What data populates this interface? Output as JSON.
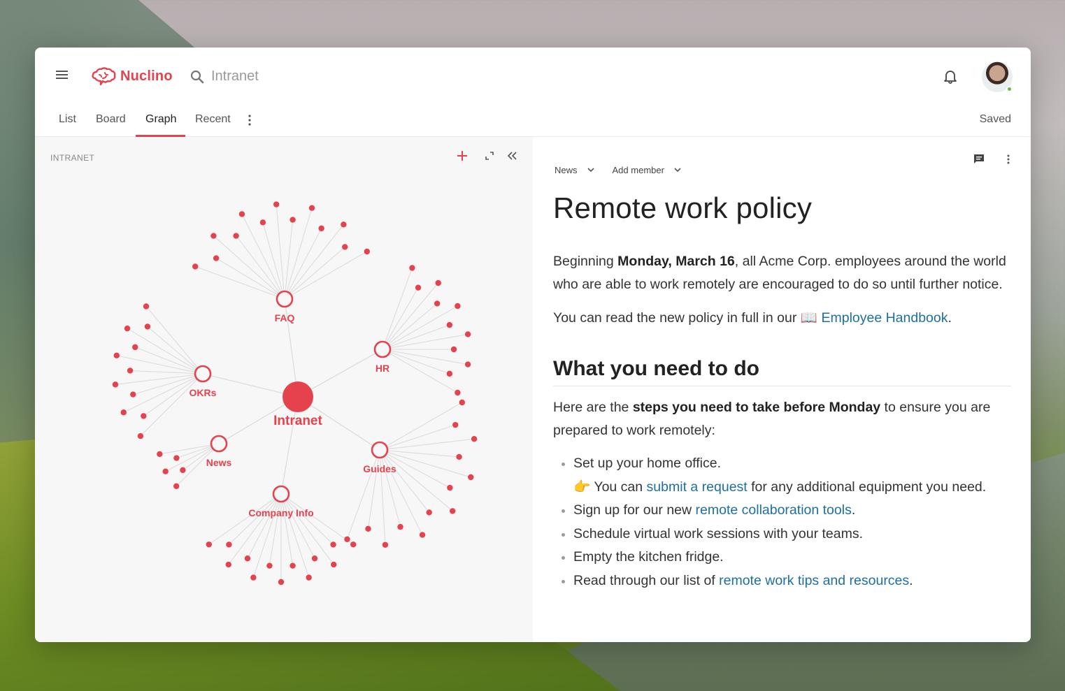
{
  "app": {
    "name": "Nuclino",
    "brand_color": "#e5424d",
    "link_color": "#1e6f9e"
  },
  "header": {
    "search_text": "Intranet",
    "icons": [
      "menu-icon",
      "search-icon",
      "bell-icon"
    ]
  },
  "tabs": [
    {
      "label": "List"
    },
    {
      "label": "Board"
    },
    {
      "label": "Graph",
      "active": true
    },
    {
      "label": "Recent"
    }
  ],
  "status": "Saved",
  "left_pane": {
    "title": "INTRANET",
    "tools": [
      "add-icon",
      "expand-icon",
      "collapse-icon"
    ]
  },
  "graph": {
    "center": "Intranet",
    "clusters": [
      {
        "label": "FAQ",
        "children": 13
      },
      {
        "label": "HR",
        "children": 11
      },
      {
        "label": "OKRs",
        "children": 11
      },
      {
        "label": "News",
        "children": 5
      },
      {
        "label": "Guides",
        "children": 13
      },
      {
        "label": "Company Info",
        "children": 13
      }
    ]
  },
  "document": {
    "meta": {
      "collection": "News",
      "add_member": "Add member"
    },
    "title": "Remote work policy",
    "p1": {
      "t1": "Beginning ",
      "b1": "Monday, March 16",
      "t2": ", all Acme Corp. employees around the world who are able to work remotely are encouraged to do so until further notice."
    },
    "p2": {
      "t1": "You can read the new policy in full in our ",
      "emoji": "📖",
      "link": "Employee Handbook",
      "t2": "."
    },
    "h2": "What you need to do",
    "p3": {
      "t1": "Here are the ",
      "b1": "steps you need to take before Monday",
      "t2": " to ensure you are prepared to work remotely:"
    },
    "list": {
      "item1": "Set up your home office.",
      "item1_sub": {
        "emoji": "👉",
        "t1": "You can ",
        "link": "submit a request",
        "t2": " for any additional equipment you need."
      },
      "item2": {
        "t1": "Sign up for our new ",
        "link": "remote collaboration tools",
        "t2": "."
      },
      "item3": "Schedule virtual work sessions with your teams.",
      "item4": "Empty the kitchen fridge.",
      "item5": {
        "t1": "Read through our list of ",
        "link": "remote work tips and resources",
        "t2": "."
      }
    }
  }
}
